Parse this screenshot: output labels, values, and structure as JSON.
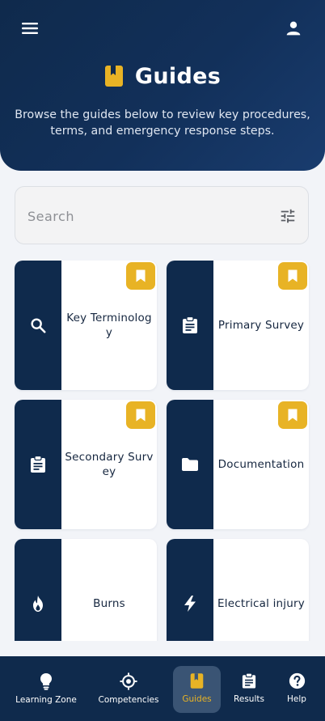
{
  "header": {
    "title": "Guides",
    "subtitle": "Browse the guides below to review key procedures, terms, and emergency response steps."
  },
  "search": {
    "placeholder": "Search",
    "value": ""
  },
  "icons": {
    "menu": "menu-icon",
    "user": "user-icon",
    "title": "book-icon",
    "filter": "tune-icon",
    "bookmark": "bookmark-icon"
  },
  "guides": [
    {
      "label": "Key Terminology",
      "icon": "search-icon",
      "bookmarked": true
    },
    {
      "label": "Primary Survey",
      "icon": "clipboard-icon",
      "bookmarked": true
    },
    {
      "label": "Secondary Survey",
      "icon": "clipboard-icon",
      "bookmarked": true
    },
    {
      "label": "Documentation",
      "icon": "folder-icon",
      "bookmarked": true
    },
    {
      "label": "Burns",
      "icon": "fire-icon",
      "bookmarked": false
    },
    {
      "label": "Electrical injury",
      "icon": "bolt-icon",
      "bookmarked": false
    }
  ],
  "nav": [
    {
      "label": "Learning Zone",
      "icon": "lightbulb-icon",
      "active": false
    },
    {
      "label": "Competencies",
      "icon": "target-icon",
      "active": false
    },
    {
      "label": "Guides",
      "icon": "book-icon",
      "active": true
    },
    {
      "label": "Results",
      "icon": "clipboard-icon",
      "active": false
    },
    {
      "label": "Help",
      "icon": "help-icon",
      "active": false
    }
  ],
  "colors": {
    "primary": "#0f2a4c",
    "accent": "#e8b325",
    "background": "#f2f4f8",
    "card": "#ffffff"
  }
}
